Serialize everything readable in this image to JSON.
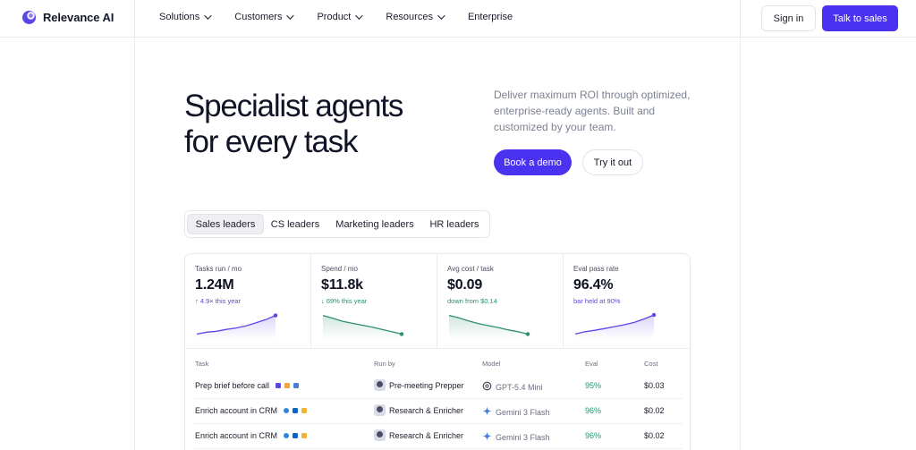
{
  "nav": {
    "brand": "Relevance AI",
    "links": [
      {
        "label": "Solutions",
        "dropdown": true
      },
      {
        "label": "Customers",
        "dropdown": true
      },
      {
        "label": "Product",
        "dropdown": true
      },
      {
        "label": "Resources",
        "dropdown": true
      },
      {
        "label": "Enterprise",
        "dropdown": false
      }
    ],
    "sign_in": "Sign in",
    "talk_to_sales": "Talk to sales"
  },
  "hero": {
    "title_line1": "Specialist agents",
    "title_line2": "for every task",
    "description": "Deliver maximum ROI through optimized, enterprise-ready agents. Built and customized by your team.",
    "book_demo": "Book a demo",
    "try_it_out": "Try it out"
  },
  "tabs": [
    {
      "label": "Sales leaders",
      "active": true
    },
    {
      "label": "CS leaders",
      "active": false
    },
    {
      "label": "Marketing leaders",
      "active": false
    },
    {
      "label": "HR leaders",
      "active": false
    }
  ],
  "stats": [
    {
      "label": "Tasks run / mo",
      "value": "1.24M",
      "sub": "↑ 4.9× this year",
      "trend": "up",
      "color": "#5b46e6",
      "points": [
        0.1,
        0.18,
        0.22,
        0.3,
        0.36,
        0.45,
        0.58,
        0.72,
        0.9
      ]
    },
    {
      "label": "Spend / mo",
      "value": "$11.8k",
      "sub": "↓ 69% this year",
      "trend": "down",
      "color": "#2e8f6f",
      "points": [
        0.9,
        0.78,
        0.65,
        0.56,
        0.48,
        0.4,
        0.3,
        0.2,
        0.1
      ]
    },
    {
      "label": "Avg cost / task",
      "value": "$0.09",
      "sub": "down from $0.14",
      "trend": "down",
      "color": "#2e8f6f",
      "points": [
        0.9,
        0.8,
        0.66,
        0.55,
        0.46,
        0.38,
        0.28,
        0.2,
        0.1
      ]
    },
    {
      "label": "Eval pass rate",
      "value": "96.4%",
      "sub": "bar held at 90%",
      "trend": "up",
      "color": "#5b46e6",
      "points": [
        0.1,
        0.2,
        0.26,
        0.34,
        0.42,
        0.5,
        0.6,
        0.75,
        0.92
      ]
    }
  ],
  "colors": {
    "accent": "#4b32f0",
    "purple_sub": "#5b46e6",
    "green_sub": "#2e8f6f",
    "eval_green": "#1c9a6a"
  },
  "table": {
    "headers": {
      "task": "Task",
      "run_by": "Run by",
      "model": "Model",
      "eval": "Eval",
      "cost": "Cost"
    },
    "rows": [
      {
        "task": "Prep brief before call",
        "tools": [
          "#5b46e6",
          "#f2a33b",
          "#4a7bd8"
        ],
        "agent": "Pre-meeting Prepper",
        "model_icon": "openai-icon",
        "model": "GPT-5.4 Mini",
        "eval": "95%",
        "cost": "$0.03"
      },
      {
        "task": "Enrich account in CRM",
        "tools": [
          "#2f86d6",
          "#0a66c2",
          "#f2b233"
        ],
        "agent": "Research & Enricher",
        "model_icon": "gemini-icon",
        "model": "Gemini 3 Flash",
        "eval": "96%",
        "cost": "$0.02"
      },
      {
        "task": "Enrich account in CRM",
        "tools": [
          "#2f86d6",
          "#0a66c2",
          "#f2b233"
        ],
        "agent": "Research & Enricher",
        "model_icon": "gemini-icon",
        "model": "Gemini 3 Flash",
        "eval": "96%",
        "cost": "$0.02"
      }
    ]
  }
}
